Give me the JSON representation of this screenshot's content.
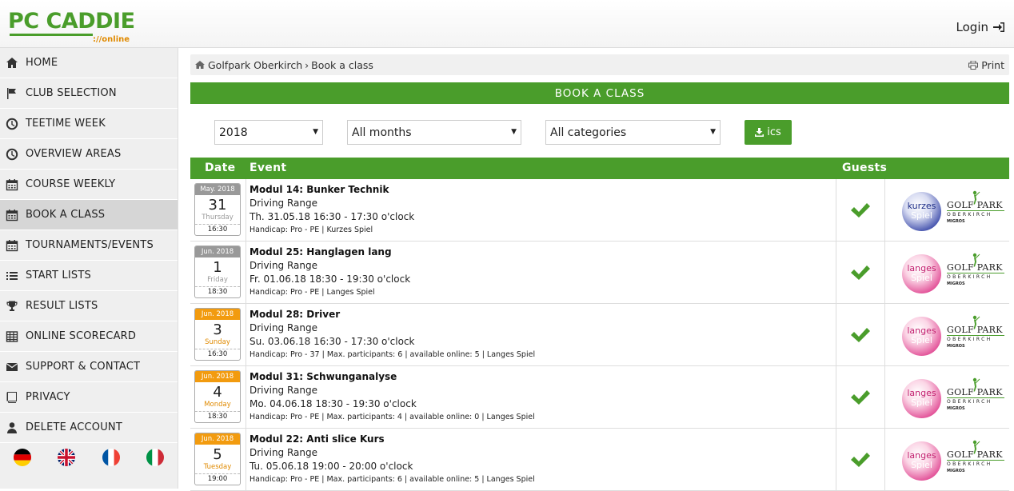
{
  "header": {
    "logo_text": "PC CADDIE",
    "logo_sub": "://online",
    "login_label": "Login"
  },
  "sidebar": {
    "items": [
      {
        "label": "HOME",
        "icon": "home-icon"
      },
      {
        "label": "CLUB SELECTION",
        "icon": "flag-icon"
      },
      {
        "label": "TEETIME WEEK",
        "icon": "clock-icon"
      },
      {
        "label": "OVERVIEW AREAS",
        "icon": "clock-icon"
      },
      {
        "label": "COURSE WEEKLY",
        "icon": "calendar-icon"
      },
      {
        "label": "BOOK A CLASS",
        "icon": "calendar-icon",
        "active": true
      },
      {
        "label": "TOURNAMENTS/EVENTS",
        "icon": "calendar-icon"
      },
      {
        "label": "START LISTS",
        "icon": "list-icon"
      },
      {
        "label": "RESULT LISTS",
        "icon": "trophy-icon"
      },
      {
        "label": "ONLINE SCORECARD",
        "icon": "table-icon"
      },
      {
        "label": "SUPPORT & CONTACT",
        "icon": "envelope-icon"
      },
      {
        "label": "PRIVACY",
        "icon": "book-icon"
      },
      {
        "label": "DELETE ACCOUNT",
        "icon": "user-icon"
      }
    ],
    "languages": [
      "de",
      "en",
      "fr",
      "it"
    ]
  },
  "breadcrumb": {
    "club": "Golfpark Oberkirch",
    "separator": "›",
    "page": "Book a class",
    "print_label": "Print"
  },
  "page_title": "BOOK A CLASS",
  "filters": {
    "year": "2018",
    "month": "All months",
    "category": "All categories",
    "ics_label": "ics"
  },
  "table": {
    "headers": {
      "date": "Date",
      "event": "Event",
      "guests": "Guests"
    },
    "rows": [
      {
        "cal_month": "May. 2018",
        "cal_day": "31",
        "cal_weekday": "Thursday",
        "cal_time": "16:30",
        "cal_color": "grey",
        "title": "Modul 14: Bunker Technik",
        "location": "Driving Range",
        "datetime": "Th. 31.05.18 16:30 - 17:30 o'clock",
        "details": "Handicap: Pro - PE  | Kurzes Spiel",
        "ball_color": "blue",
        "ball_t1": "kurzes",
        "ball_t2": "Spiel"
      },
      {
        "cal_month": "Jun. 2018",
        "cal_day": "1",
        "cal_weekday": "Friday",
        "cal_time": "18:30",
        "cal_color": "grey",
        "title": "Modul 25: Hanglagen lang",
        "location": "Driving Range",
        "datetime": "Fr. 01.06.18 18:30 - 19:30 o'clock",
        "details": "Handicap: Pro - PE  | Langes Spiel",
        "ball_color": "pink",
        "ball_t1": "langes",
        "ball_t2": "Spiel"
      },
      {
        "cal_month": "Jun. 2018",
        "cal_day": "3",
        "cal_weekday": "Sunday",
        "cal_time": "16:30",
        "cal_color": "orange",
        "title": "Modul 28: Driver",
        "location": "Driving Range",
        "datetime": "Su. 03.06.18 16:30 - 17:30 o'clock",
        "details": "Handicap: Pro - 37  | Max. participants: 6 | available online: 5 | Langes Spiel",
        "ball_color": "pink",
        "ball_t1": "langes",
        "ball_t2": "Spiel"
      },
      {
        "cal_month": "Jun. 2018",
        "cal_day": "4",
        "cal_weekday": "Monday",
        "cal_time": "18:30",
        "cal_color": "orange",
        "title": "Modul 31: Schwunganalyse",
        "location": "Driving Range",
        "datetime": "Mo. 04.06.18 18:30 - 19:30 o'clock",
        "details": "Handicap: Pro - PE  | Max. participants: 4 | available online: 0 | Langes Spiel",
        "ball_color": "pink",
        "ball_t1": "langes",
        "ball_t2": "Spiel"
      },
      {
        "cal_month": "Jun. 2018",
        "cal_day": "5",
        "cal_weekday": "Tuesday",
        "cal_time": "19:00",
        "cal_color": "orange",
        "title": "Modul 22: Anti slice Kurs",
        "location": "Driving Range",
        "datetime": "Tu. 05.06.18 19:00 - 20:00 o'clock",
        "details": "Handicap: Pro - PE  | Max. participants: 6 | available online: 5 | Langes Spiel",
        "ball_color": "pink",
        "ball_t1": "langes",
        "ball_t2": "Spiel"
      }
    ]
  },
  "club_logo": {
    "name": "GOLF PARK",
    "sub": "OBERKIRCH",
    "sponsor": "MIGROS"
  },
  "colors": {
    "brand_green": "#4a9d2b",
    "accent_orange": "#f29b0f"
  }
}
